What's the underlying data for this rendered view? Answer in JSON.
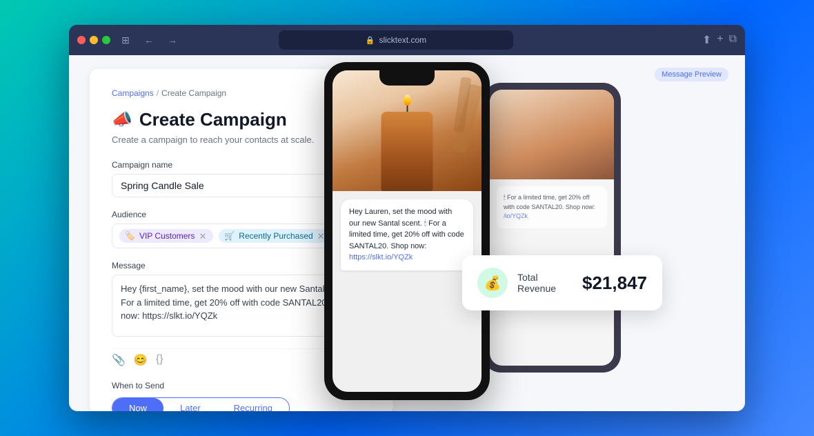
{
  "browser": {
    "url": "slicktext.com",
    "tab_icon": "🔒"
  },
  "breadcrumb": {
    "link": "Campaigns",
    "separator": "/",
    "current": "Create Campaign"
  },
  "page": {
    "emoji": "📣",
    "title": "Create Campaign",
    "subtitle": "Create a campaign to reach your contacts at scale."
  },
  "form": {
    "campaign_name_label": "Campaign name",
    "campaign_name_value": "Spring Candle Sale",
    "audience_label": "Audience",
    "message_label": "Message",
    "message_value": "Hey {first_name}, set the mood with our new Santal scent. 🕯 For a limited time, get 20% off with code SANTAL20. Shop now: https://slkt.io/YQZk",
    "when_to_send_label": "When to Send",
    "send_options": [
      "Now",
      "Later",
      "Recurring"
    ],
    "active_send_option": "Now"
  },
  "audience_tags": [
    {
      "label": "VIP Customers",
      "type": "vip",
      "icon": "🏷️"
    },
    {
      "label": "Recently Purchased",
      "type": "recent",
      "icon": "🛒"
    }
  ],
  "phone": {
    "message": "Hey Lauren, set the mood with our new Santal scent. 🕯 For a limited time, get 20% off with code SANTAL20. Shop now:",
    "link": "https://slkt.io/YQZk"
  },
  "revenue": {
    "icon": "💰",
    "label": "Total Revenue",
    "amount": "$21,847"
  },
  "message_preview_badge": "Message Preview",
  "toolbar_icons": {
    "attachment": "📎",
    "emoji": "😊",
    "code": "{}"
  }
}
